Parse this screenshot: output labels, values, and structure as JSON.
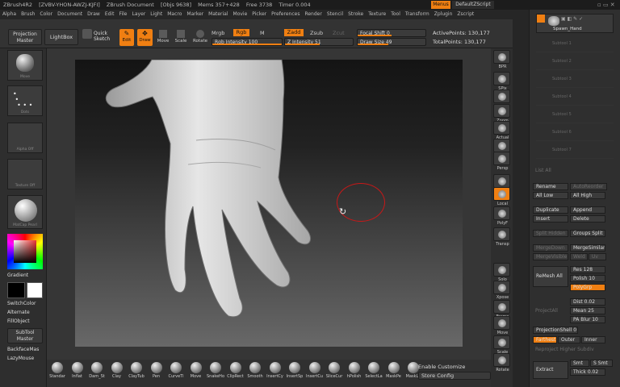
{
  "titlebar": {
    "app": "ZBrush4R2",
    "code": "[ZVBV-YHON-AWZJ-KJFI]",
    "doc": "ZBrush Document",
    "objs": "[Objs 9638]",
    "mems": "Mems 357+428",
    "free": "Free 3738",
    "timer": "Timer 0.004",
    "menus_btn": "Menus",
    "script": "DefaultZScript"
  },
  "menubar": [
    "Alpha",
    "Brush",
    "Color",
    "Document",
    "Draw",
    "Edit",
    "File",
    "Layer",
    "Light",
    "Macro",
    "Marker",
    "Material",
    "Movie",
    "Picker",
    "Preferences",
    "Render",
    "Stencil",
    "Stroke",
    "Texture",
    "Tool",
    "Transform",
    "Zplugin",
    "Zscript"
  ],
  "toolbar": {
    "projection": "Projection Master",
    "lightbox": "LightBox",
    "quick_sketch": "Quick Sketch",
    "edit": "Edit",
    "draw": "Draw",
    "move": "Move",
    "scale": "Scale",
    "rotate": "Rotate",
    "mrgb": "Mrgb",
    "rgb": "Rgb",
    "m": "M",
    "rgb_intensity": "Rgb Intensity 100",
    "zadd": "Zadd",
    "zsub": "Zsub",
    "zcut": "Zcut",
    "z_intensity": "Z Intensity 51",
    "focal_shift": "Focal Shift 0",
    "draw_size": "Draw Size 49",
    "active_points": "ActivePoints: 130,177",
    "total_points": "TotalPoints: 130,177"
  },
  "leftshelf": {
    "tile1": "Move",
    "tile2": "Dots",
    "tile3": "Alpha Off",
    "tile4": "Texture Off",
    "tile5": "MatCap Pearl",
    "gradient": "Gradient",
    "switch_color": "SwitchColor",
    "alternate": "Alternate",
    "fill_object": "FillObject",
    "subtool_master": "SubTool Master",
    "backface": "BackfaceMas",
    "lazymouse": "LazyMouse"
  },
  "bottomshelf": {
    "brushes": [
      "Standar",
      "Inflat",
      "Dam_St",
      "Clay",
      "ClayTub",
      "Pen",
      "CurveTi",
      "Move",
      "SnakeHo",
      "ClipRect",
      "Smooth",
      "InsertCy",
      "InsertSp",
      "InsertCu",
      "SliceCur",
      "hPolish",
      "SelectLa",
      "MaskPe",
      "MaskLa"
    ],
    "enable_customize": "Enable Customize",
    "store_config": "Store Config"
  },
  "rightshelf": [
    "BPR",
    "SPix",
    "Scroll",
    "Zoom",
    "Actual",
    "AAHalf",
    "Persp",
    "Floor",
    "Local",
    "PolyF",
    "Transp",
    "Solo",
    "Xpose",
    "Frame",
    "Move",
    "Scale",
    "Rotate"
  ],
  "subtool": {
    "active": "Spawn_Hand",
    "slots": [
      "Subtool 1",
      "Subtool 2",
      "Subtool 3",
      "Subtool 4",
      "Subtool 5",
      "Subtool 6",
      "Subtool 7"
    ],
    "list_all": "List All",
    "rename": "Rename",
    "autoreorder": "AutoReorder",
    "all_low": "All Low",
    "all_high": "All High",
    "duplicate": "Duplicate",
    "append": "Append",
    "insert": "Insert",
    "delete": "Delete",
    "split_hidden": "Split Hidden",
    "groups_split": "Groups Split",
    "merge_down": "MergeDown",
    "merge_similar": "MergeSimilar",
    "merge_visible": "MergeVisible",
    "weld": "Weld",
    "uv": "Uv",
    "remesh_all": "ReMesh All",
    "res": "Res 128",
    "polish": "Polish 10",
    "polygrp": "PolyGrp",
    "project_all": "ProjectAll",
    "dist": "Dist 0.02",
    "mean": "Mean 25",
    "pa_blur": "PA Blur 10",
    "projection_shell": "ProjectionShell 0",
    "farthest": "Farthest",
    "outer": "Outer",
    "inner": "Inner",
    "reproject": "Reproject Higher Subdiv",
    "extract": "Extract",
    "smt": "Smt",
    "s_smt": "S Smt",
    "thick": "Thick 0.02"
  }
}
